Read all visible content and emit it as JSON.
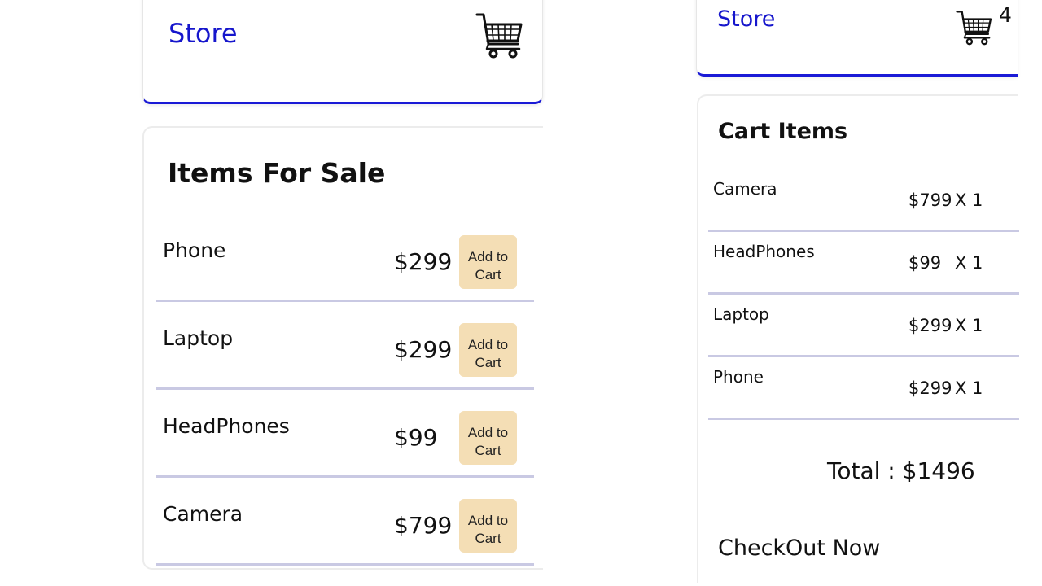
{
  "left_screen": {
    "header": {
      "brand": "Store",
      "cart_icon": "shopping-cart-icon"
    },
    "items_card": {
      "title": "Items For Sale",
      "items": [
        {
          "name": "Phone",
          "price": "$299",
          "button": [
            "Add to",
            "Cart"
          ]
        },
        {
          "name": "Laptop",
          "price": "$299",
          "button": [
            "Add to",
            "Cart"
          ]
        },
        {
          "name": "HeadPhones",
          "price": "$99",
          "button": [
            "Add to",
            "Cart"
          ]
        },
        {
          "name": "Camera",
          "price": "$799",
          "button": [
            "Add to",
            "Cart"
          ]
        }
      ]
    }
  },
  "right_screen": {
    "header": {
      "brand": "Store",
      "cart_icon": "shopping-cart-icon",
      "cart_count": "4"
    },
    "cart_card": {
      "title": "Cart Items",
      "items": [
        {
          "name": "Camera",
          "price": "$799",
          "qty": "X 1"
        },
        {
          "name": "HeadPhones",
          "price": "$99",
          "qty": "X 1"
        },
        {
          "name": "Laptop",
          "price": "$299",
          "qty": "X 1"
        },
        {
          "name": "Phone",
          "price": "$299",
          "qty": "X 1"
        }
      ],
      "total_label": "Total : ",
      "total_value": "$1496",
      "checkout_label": "CheckOut Now"
    }
  },
  "colors": {
    "brand": "#1616cc",
    "header_border": "#1a1ad6",
    "button_bg": "#f4deb5",
    "divider": "#c9c9e3"
  }
}
